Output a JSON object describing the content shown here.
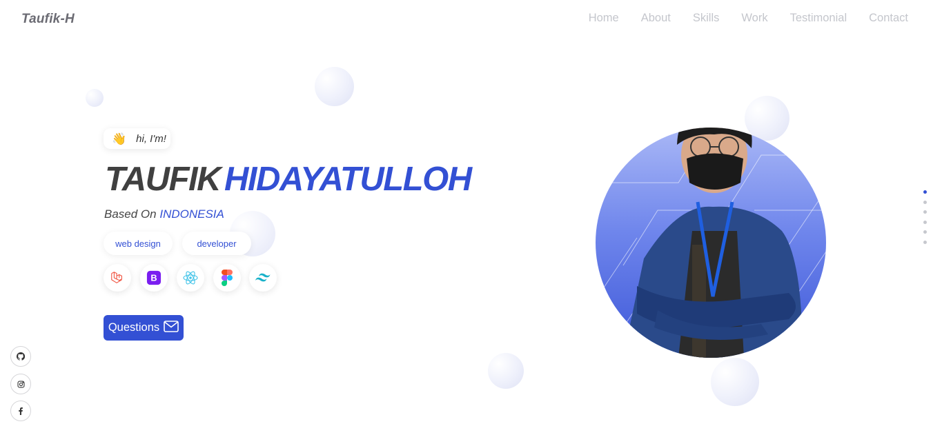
{
  "header": {
    "logo": "Taufik-H",
    "nav": [
      "Home",
      "About",
      "Skills",
      "Work",
      "Testimonial",
      "Contact"
    ]
  },
  "hero": {
    "greeting_icon": "waving-hand-emoji",
    "greeting": "hi, I'm!",
    "first_name": "TAUFIK",
    "last_name": "HIDAYATULLOH",
    "based_prefix": "Based On",
    "country": "INDONESIA",
    "tags": [
      "web design",
      "developer"
    ],
    "tech_icons": [
      "laravel-icon",
      "bootstrap-icon",
      "react-icon",
      "figma-icon",
      "tailwind-icon"
    ],
    "cta_label": "Questions",
    "cta_icon": "envelope-icon"
  },
  "social": [
    "github-icon",
    "instagram-icon",
    "facebook-icon"
  ],
  "section_dots": {
    "count": 6,
    "active_index": 0
  },
  "colors": {
    "accent": "#3350d4",
    "text_dark": "#404040",
    "nav_text": "#c4c6cc",
    "logo": "#6b6b73"
  }
}
